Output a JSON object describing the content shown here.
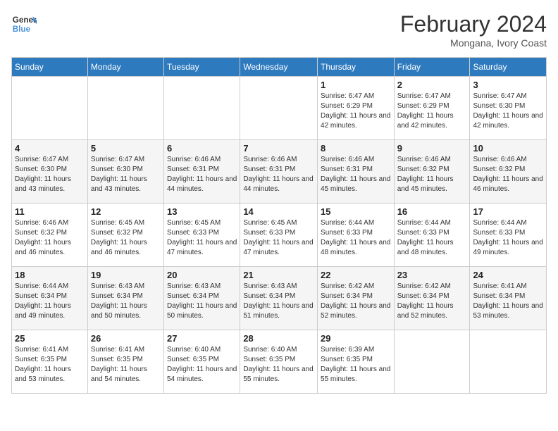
{
  "header": {
    "logo_line1": "General",
    "logo_line2": "Blue",
    "title": "February 2024",
    "subtitle": "Mongana, Ivory Coast"
  },
  "days_of_week": [
    "Sunday",
    "Monday",
    "Tuesday",
    "Wednesday",
    "Thursday",
    "Friday",
    "Saturday"
  ],
  "weeks": [
    [
      {
        "day": "",
        "info": ""
      },
      {
        "day": "",
        "info": ""
      },
      {
        "day": "",
        "info": ""
      },
      {
        "day": "",
        "info": ""
      },
      {
        "day": "1",
        "info": "Sunrise: 6:47 AM\nSunset: 6:29 PM\nDaylight: 11 hours and 42 minutes."
      },
      {
        "day": "2",
        "info": "Sunrise: 6:47 AM\nSunset: 6:29 PM\nDaylight: 11 hours and 42 minutes."
      },
      {
        "day": "3",
        "info": "Sunrise: 6:47 AM\nSunset: 6:30 PM\nDaylight: 11 hours and 42 minutes."
      }
    ],
    [
      {
        "day": "4",
        "info": "Sunrise: 6:47 AM\nSunset: 6:30 PM\nDaylight: 11 hours and 43 minutes."
      },
      {
        "day": "5",
        "info": "Sunrise: 6:47 AM\nSunset: 6:30 PM\nDaylight: 11 hours and 43 minutes."
      },
      {
        "day": "6",
        "info": "Sunrise: 6:46 AM\nSunset: 6:31 PM\nDaylight: 11 hours and 44 minutes."
      },
      {
        "day": "7",
        "info": "Sunrise: 6:46 AM\nSunset: 6:31 PM\nDaylight: 11 hours and 44 minutes."
      },
      {
        "day": "8",
        "info": "Sunrise: 6:46 AM\nSunset: 6:31 PM\nDaylight: 11 hours and 45 minutes."
      },
      {
        "day": "9",
        "info": "Sunrise: 6:46 AM\nSunset: 6:32 PM\nDaylight: 11 hours and 45 minutes."
      },
      {
        "day": "10",
        "info": "Sunrise: 6:46 AM\nSunset: 6:32 PM\nDaylight: 11 hours and 46 minutes."
      }
    ],
    [
      {
        "day": "11",
        "info": "Sunrise: 6:46 AM\nSunset: 6:32 PM\nDaylight: 11 hours and 46 minutes."
      },
      {
        "day": "12",
        "info": "Sunrise: 6:45 AM\nSunset: 6:32 PM\nDaylight: 11 hours and 46 minutes."
      },
      {
        "day": "13",
        "info": "Sunrise: 6:45 AM\nSunset: 6:33 PM\nDaylight: 11 hours and 47 minutes."
      },
      {
        "day": "14",
        "info": "Sunrise: 6:45 AM\nSunset: 6:33 PM\nDaylight: 11 hours and 47 minutes."
      },
      {
        "day": "15",
        "info": "Sunrise: 6:44 AM\nSunset: 6:33 PM\nDaylight: 11 hours and 48 minutes."
      },
      {
        "day": "16",
        "info": "Sunrise: 6:44 AM\nSunset: 6:33 PM\nDaylight: 11 hours and 48 minutes."
      },
      {
        "day": "17",
        "info": "Sunrise: 6:44 AM\nSunset: 6:33 PM\nDaylight: 11 hours and 49 minutes."
      }
    ],
    [
      {
        "day": "18",
        "info": "Sunrise: 6:44 AM\nSunset: 6:34 PM\nDaylight: 11 hours and 49 minutes."
      },
      {
        "day": "19",
        "info": "Sunrise: 6:43 AM\nSunset: 6:34 PM\nDaylight: 11 hours and 50 minutes."
      },
      {
        "day": "20",
        "info": "Sunrise: 6:43 AM\nSunset: 6:34 PM\nDaylight: 11 hours and 50 minutes."
      },
      {
        "day": "21",
        "info": "Sunrise: 6:43 AM\nSunset: 6:34 PM\nDaylight: 11 hours and 51 minutes."
      },
      {
        "day": "22",
        "info": "Sunrise: 6:42 AM\nSunset: 6:34 PM\nDaylight: 11 hours and 52 minutes."
      },
      {
        "day": "23",
        "info": "Sunrise: 6:42 AM\nSunset: 6:34 PM\nDaylight: 11 hours and 52 minutes."
      },
      {
        "day": "24",
        "info": "Sunrise: 6:41 AM\nSunset: 6:34 PM\nDaylight: 11 hours and 53 minutes."
      }
    ],
    [
      {
        "day": "25",
        "info": "Sunrise: 6:41 AM\nSunset: 6:35 PM\nDaylight: 11 hours and 53 minutes."
      },
      {
        "day": "26",
        "info": "Sunrise: 6:41 AM\nSunset: 6:35 PM\nDaylight: 11 hours and 54 minutes."
      },
      {
        "day": "27",
        "info": "Sunrise: 6:40 AM\nSunset: 6:35 PM\nDaylight: 11 hours and 54 minutes."
      },
      {
        "day": "28",
        "info": "Sunrise: 6:40 AM\nSunset: 6:35 PM\nDaylight: 11 hours and 55 minutes."
      },
      {
        "day": "29",
        "info": "Sunrise: 6:39 AM\nSunset: 6:35 PM\nDaylight: 11 hours and 55 minutes."
      },
      {
        "day": "",
        "info": ""
      },
      {
        "day": "",
        "info": ""
      }
    ]
  ]
}
